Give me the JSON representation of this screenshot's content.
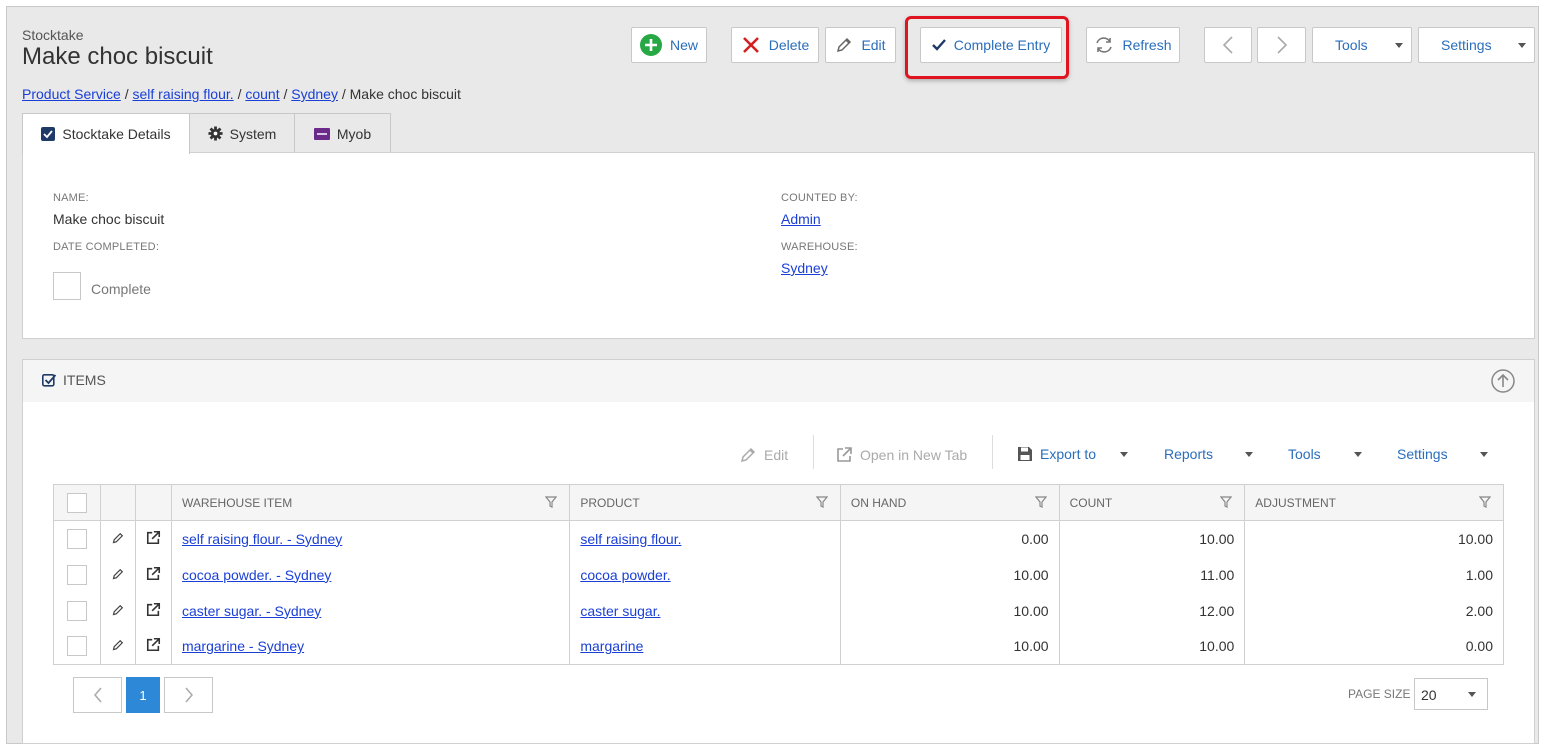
{
  "header": {
    "section_label": "Stocktake",
    "title": "Make choc biscuit"
  },
  "toolbar": {
    "new_label": "New",
    "delete_label": "Delete",
    "edit_label": "Edit",
    "complete_label": "Complete Entry",
    "refresh_label": "Refresh",
    "tools_label": "Tools",
    "settings_label": "Settings"
  },
  "breadcrumb": {
    "items": [
      "Product Service",
      "self raising flour.",
      "count",
      "Sydney"
    ],
    "current": "Make choc biscuit",
    "separator": "/"
  },
  "tabs": [
    {
      "label": "Stocktake Details",
      "icon": "checkbox-icon"
    },
    {
      "label": "System",
      "icon": "gear-icon"
    },
    {
      "label": "Myob",
      "icon": "myob-icon"
    }
  ],
  "details": {
    "name_label": "NAME:",
    "name_value": "Make choc biscuit",
    "date_completed_label": "DATE COMPLETED:",
    "complete_checkbox_label": "Complete",
    "counted_by_label": "COUNTED BY:",
    "counted_by_value": "Admin",
    "warehouse_label": "WAREHOUSE:",
    "warehouse_value": "Sydney"
  },
  "items_panel": {
    "title": "ITEMS",
    "toolbar": {
      "edit_label": "Edit",
      "open_new_tab_label": "Open in New Tab",
      "export_label": "Export to",
      "reports_label": "Reports",
      "tools_label": "Tools",
      "settings_label": "Settings"
    },
    "columns": [
      "WAREHOUSE ITEM",
      "PRODUCT",
      "ON HAND",
      "COUNT",
      "ADJUSTMENT"
    ],
    "rows": [
      {
        "warehouse_item": "self raising flour. - Sydney",
        "product": "self raising flour.",
        "on_hand": "0.00",
        "count": "10.00",
        "adjustment": "10.00"
      },
      {
        "warehouse_item": "cocoa powder. - Sydney",
        "product": "cocoa powder.",
        "on_hand": "10.00",
        "count": "11.00",
        "adjustment": "1.00"
      },
      {
        "warehouse_item": "caster sugar. - Sydney",
        "product": "caster sugar.",
        "on_hand": "10.00",
        "count": "12.00",
        "adjustment": "2.00"
      },
      {
        "warehouse_item": "margarine - Sydney",
        "product": "margarine",
        "on_hand": "10.00",
        "count": "10.00",
        "adjustment": "0.00"
      }
    ],
    "pagination": {
      "current_page": "1",
      "page_size_label": "PAGE SIZE",
      "page_size_value": "20"
    }
  },
  "colors": {
    "link": "#1a3fd6",
    "accent_blue": "#2a6ebb",
    "new_green": "#27a844",
    "delete_red": "#d42020",
    "highlight_red": "#e0141e",
    "page_active": "#2d89d8"
  }
}
